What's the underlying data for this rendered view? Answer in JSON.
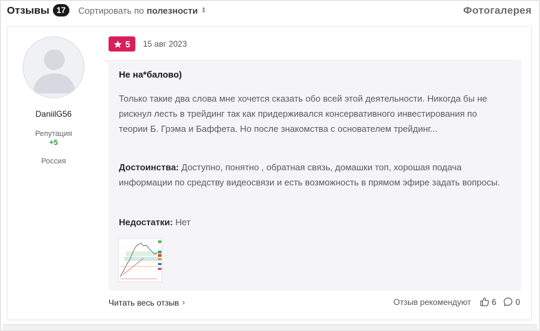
{
  "header": {
    "title": "Отзывы",
    "count": "17",
    "sort_prefix": "Сортировать по",
    "sort_value": "полезности",
    "gallery_link": "Фотогалерея"
  },
  "author": {
    "name": "DaniilG56",
    "reputation_label": "Репутация",
    "reputation_value": "+5",
    "country": "Россия"
  },
  "review": {
    "rating": "5",
    "date": "15 авг 2023",
    "title": "Не на*балово)",
    "text": "Только такие два слова мне хочется сказать обо всей этой деятельности. Никогда бы не рискнул лесть в трейдинг так как придерживался консервативного инвестирования по теории Б. Грэма и Баффета. Но после знакомства с основателем трейдинг...",
    "pros_label": "Достоинства:",
    "pros_text": " Доступно, понятно , обратная связь, домашки топ, хорошая подача информации по средству видеосвязи и есть возможность в прямом эфире задать вопросы.",
    "cons_label": "Недостатки:",
    "cons_text": " Нет",
    "attachment_icon": "chart-screenshot-thumbnail"
  },
  "footer": {
    "read_more": "Читать весь отзыв",
    "recommend_label": "Отзыв рекомендуют",
    "likes": "6",
    "comments": "0"
  },
  "colors": {
    "rating_bg": "#d81f5a",
    "reputation_positive": "#22a046",
    "bubble_bg": "#f5f5f7"
  }
}
